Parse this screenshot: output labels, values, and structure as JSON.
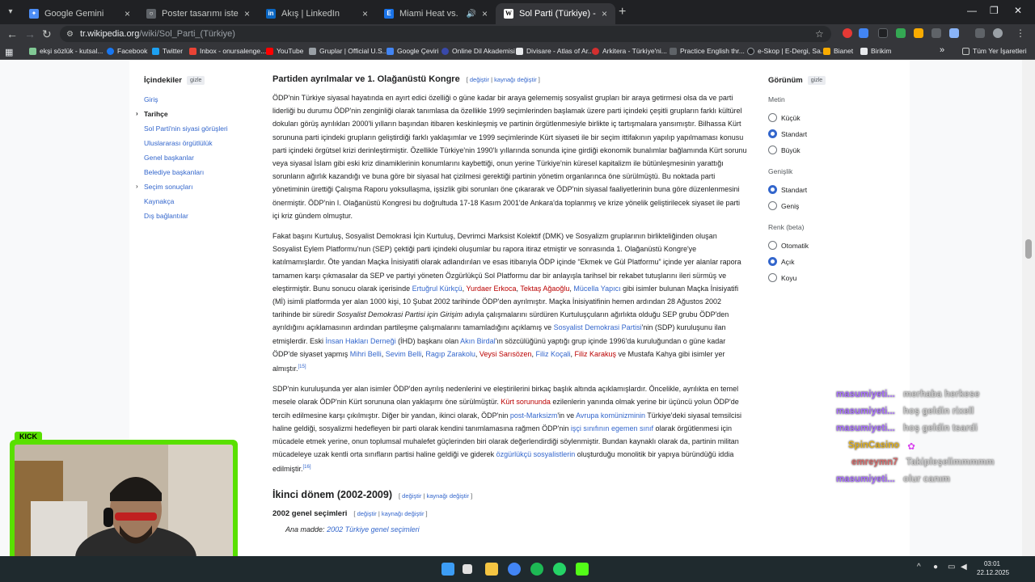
{
  "tabs": [
    {
      "label": "Google Gemini",
      "active": false
    },
    {
      "label": "Poster tasarımı isteği",
      "active": false
    },
    {
      "label": "Akış | LinkedIn",
      "active": false
    },
    {
      "label": "Miami Heat vs. New York K",
      "active": false
    },
    {
      "label": "Sol Parti (Türkiye) - Vikipedi",
      "active": true
    }
  ],
  "address": {
    "domain": "tr.wikipedia.org",
    "path": "/wiki/Sol_Parti_(Türkiye)"
  },
  "bookmarks": [
    "ekşi sözlük - kutsal...",
    "Facebook",
    "Twitter",
    "Inbox - onursalenge...",
    "YouTube",
    "Gruplar | Official U.S...",
    "Google Çeviri",
    "Online Dil Akademisi",
    "Divisare - Atlas of Ar...",
    "Arkitera - Türkiye'ni...",
    "Practice English thr...",
    "e-Skop | E-Dergi, Sa...",
    "Bianet",
    "Birikim"
  ],
  "bookmarks_more": "»",
  "all_bookmarks": "Tüm Yer İşaretleri",
  "toc": {
    "title": "İçindekiler",
    "hide": "gizle",
    "items": [
      {
        "label": "Giriş",
        "current": false,
        "expandable": false
      },
      {
        "label": "Tarihçe",
        "current": true,
        "expandable": true
      },
      {
        "label": "Sol Parti'nin siyasi görüşleri",
        "current": false,
        "expandable": false
      },
      {
        "label": "Uluslararası örgütlülük",
        "current": false,
        "expandable": false
      },
      {
        "label": "Genel başkanlar",
        "current": false,
        "expandable": false
      },
      {
        "label": "Belediye başkanları",
        "current": false,
        "expandable": false
      },
      {
        "label": "Seçim sonuçları",
        "current": false,
        "expandable": true
      },
      {
        "label": "Kaynakça",
        "current": false,
        "expandable": false
      },
      {
        "label": "Dış bağlantılar",
        "current": false,
        "expandable": false
      }
    ]
  },
  "article": {
    "section_title": "Partiden ayrılmalar ve 1. Olağanüstü Kongre",
    "edit_label": "değiştir",
    "edit_source_label": "kaynağı değiştir",
    "p1": "ÖDP'nin Türkiye siyasal hayatında en ayırt edici özelliği o güne kadar bir araya gelememiş sosyalist grupları bir araya getirmesi olsa da ve parti liderliği bu durumu ÖDP'nin zenginliği olarak tanımlasa da özellikle 1999 seçimlerinden başlamak üzere parti içindeki çeşitli grupların farklı kültürel dokuları görüş ayrılıkları 2000'li yılların başından itibaren keskinleşmiş ve partinin örgütlenmesiyle birlikte iç tartışmalara yansımıştır. Bilhassa Kürt sorununa parti içindeki grupların geliştirdiği farklı yaklaşımlar ve 1999 seçimlerinde Kürt siyaseti ile bir seçim ittifakının yapılıp yapılmaması konusu parti içindeki örgütsel krizi derinleştirmiştir. Özellikle Türkiye'nin 1990'lı yıllarında sonunda içine girdiği ekonomik bunalımlar bağlamında Kürt sorunu veya siyasal İslam gibi eski kriz dinamiklerinin konumlarını kaybettiği, onun yerine Türkiye'nin küresel kapitalizm ile bütünleşmesinin yarattığı sorunların ağırlık kazandığı ve buna göre bir siyasal hat çizilmesi gerektiği partinin yönetim organlarınca öne sürülmüştü. Bu noktada parti yönetiminin ürettiği Çalışma Raporu yoksullaşma, işsizlik gibi sorunları öne çıkararak ve ÖDP'nin siyasal faaliyetlerinin buna göre düzenlenmesini önermiştir. ÖDP'nin I. Olağanüstü Kongresi bu doğrultuda 17-18 Kasım 2001'de Ankara'da toplanmış ve krize yönelik geliştirilecek siyaset ile parti içi kriz gündem olmuştur.",
    "p2": {
      "a": "Fakat başını Kurtuluş, Sosyalist Demokrasi İçin Kurtuluş, Devrimci Marksist Kolektif (DMK) ve Sosyalizm gruplarının birlikteliğinden oluşan Sosyalist Eylem Platformu'nun (SEP) çektiği parti içindeki oluşumlar bu rapora itiraz etmiştir ve sonrasında 1. Olağanüstü Kongre'ye katılmamışlardır. Öte yandan Maçka İnisiyatifi olarak adlandırılan ve esas itibarıyla ÖDP içinde “Ekmek ve Gül Platformu” içinde yer alanlar rapora tamamen karşı çıkmasalar da SEP ve partiyi yöneten Özgürlükçü Sol Platformu dar bir anlayışla tarihsel bir rekabet tutuşlarını ileri sürmüş ve eleştirmiştir. Bunu sonucu olarak içerisinde ",
      "l1": "Ertuğrul Kürkçü",
      "l2": "Yurdaer Erkoca",
      "l3": "Tektaş Ağaoğlu",
      "l4": "Mücella Yapıcı",
      "b": " gibi isimler bulunan Maçka İnisiyatifi (Mİ) isimli platformda yer alan 1000 kişi, 10 Şubat 2002 tarihinde ÖDP'den ayrılmıştır. Maçka İnisiyatifinin hemen ardından 28 Ağustos 2002 tarihinde bir süredir ",
      "italic": "Sosyalist Demokrasi Partisi için Girişim",
      "c": " adıyla çalışmalarını sürdüren Kurtuluşçuların ağırlıkta olduğu SEP grubu ÖDP'den ayrıldığını açıklamasının ardından partileşme çalışmalarını tamamladığını açıklamış ve ",
      "l5": "Sosyalist Demokrasi Partisi",
      "d": "'nin (SDP) kuruluşunu ilan etmişlerdir. Eski ",
      "l6": "İnsan Hakları Derneği",
      "e": " (İHD) başkanı olan ",
      "l7": "Akın Birdal",
      "f": "'ın sözcülüğünü yaptığı grup içinde 1996'da kuruluğundan o güne kadar ÖDP'de siyaset yapmış ",
      "l8": "Mihri Belli",
      "l9": "Sevim Belli",
      "l10": "Ragıp Zarakolu",
      "l11": "Veysi Sarısözen",
      "l12": "Filiz Koçali",
      "l13": "Filiz Karakuş",
      "g": " ve Mustafa Kahya gibi isimler yer almıştır.",
      "ref": "[15]"
    },
    "p3": {
      "a": "SDP'nin kuruluşunda yer alan isimler ÖDP'den ayrılış nedenlerini ve eleştirilerini birkaç başlık altında açıklamışlardır. Öncelikle, ayrılıkta en temel mesele olarak ÖDP'nin Kürt sorununa olan yaklaşımı öne sürülmüştür. ",
      "l1": "Kürt sorununda",
      "b": " ezilenlerin yanında olmak yerine bir üçüncü yolun ÖDP'de tercih edilmesine karşı çıkılmıştır. Diğer bir yandan, ikinci olarak, ÖDP'nin ",
      "l2": "post-Marksizm",
      "c": "'in ve ",
      "l3": "Avrupa komünizminin",
      "d": " Türkiye'deki siyasal temsilcisi haline geldiği, sosyalizmi hedefleyen bir parti olarak kendini tanımlamasına rağmen ÖDP'nin ",
      "l4": "işçi sınıfının egemen sınıf",
      "e": " olarak örgütlenmesi için mücadele etmek yerine, onun toplumsal muhalefet güçlerinden biri olarak değerlendirdiği söylenmiştir. Bundan kaynaklı olarak da, partinin militan mücadeleye uzak kentli orta sınıfların partisi haline geldiği ve giderek ",
      "l5": "özgürlükçü sosyalistlerin",
      "f": " oluşturduğu monolitik bir yapıya büründüğü iddia edilmiştir.",
      "ref": "[16]"
    },
    "h_second": "İkinci dönem (2002-2009)",
    "h_elections": "2002 genel seçimleri",
    "main_label": "Ana madde:",
    "main_link": "2002 Türkiye genel seçimleri"
  },
  "appearance": {
    "title": "Görünüm",
    "hide": "gizle",
    "groups": [
      {
        "label": "Metin",
        "options": [
          {
            "label": "Küçük",
            "checked": false
          },
          {
            "label": "Standart",
            "checked": true
          },
          {
            "label": "Büyük",
            "checked": false
          }
        ]
      },
      {
        "label": "Genişlik",
        "options": [
          {
            "label": "Standart",
            "checked": true
          },
          {
            "label": "Geniş",
            "checked": false
          }
        ]
      },
      {
        "label": "Renk (beta)",
        "options": [
          {
            "label": "Otomatik",
            "checked": false
          },
          {
            "label": "Açık",
            "checked": true
          },
          {
            "label": "Koyu",
            "checked": false
          }
        ]
      }
    ]
  },
  "chat": [
    {
      "user": "masumiyeti...",
      "text": "merhaba herkese",
      "color": "#a970ff"
    },
    {
      "user": "masumiyeti...",
      "text": "hoş geldin rixell",
      "color": "#a970ff"
    },
    {
      "user": "masumiyeti...",
      "text": "hoş geldin tsardi",
      "color": "#a970ff"
    },
    {
      "user": "SpinCasino",
      "text": "",
      "color": "#e0b020"
    },
    {
      "user": "emreymn7",
      "text": "Takipleşelimmmmm",
      "color": "#d36b6b"
    },
    {
      "user": "masumiyeti...",
      "text": "olur canım",
      "color": "#a970ff"
    }
  ],
  "webcam_label": "KICK",
  "clock": {
    "time": "03:01",
    "date": "22.12.2025"
  }
}
